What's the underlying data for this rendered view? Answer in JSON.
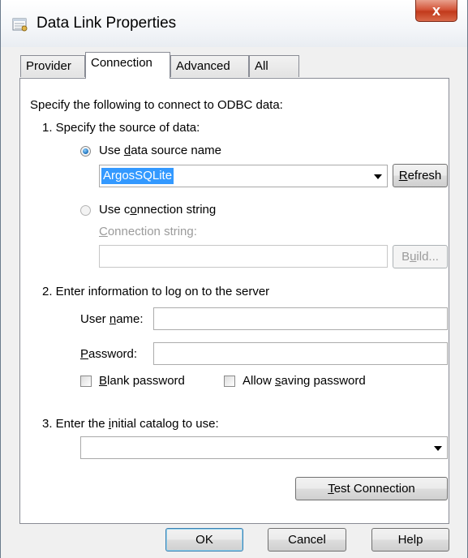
{
  "window": {
    "title": "Data Link Properties",
    "close_glyph": "x",
    "icon": "data-link-icon"
  },
  "tabs": [
    {
      "label": "Provider",
      "active": false
    },
    {
      "label": "Connection",
      "active": true
    },
    {
      "label": "Advanced",
      "active": false
    },
    {
      "label": "All",
      "active": false
    }
  ],
  "connection": {
    "intro": "Specify the following to connect to ODBC data:",
    "step1": "1. Specify the source of data:",
    "use_dsn_pre": "Use ",
    "use_dsn_accel": "d",
    "use_dsn_post": "ata source name",
    "dsn_value": "ArgosSQLite",
    "refresh_accel": "R",
    "refresh_post": "efresh",
    "use_connstr_pre": "Use c",
    "use_connstr_accel": "o",
    "use_connstr_post": "nnection string",
    "connstr_label_accel": "C",
    "connstr_label_post": "onnection string:",
    "connstr_value": "",
    "build_pre": "B",
    "build_accel": "u",
    "build_post": "ild...",
    "step2": "2. Enter information to log on to the server",
    "username_pre": "User ",
    "username_accel": "n",
    "username_post": "ame:",
    "username_value": "",
    "password_accel": "P",
    "password_post": "assword:",
    "password_value": "",
    "blank_pw_accel": "B",
    "blank_pw_post": "lank password",
    "allow_save_pre": "Allow ",
    "allow_save_accel": "s",
    "allow_save_post": "aving password",
    "step3_pre": "3. Enter the ",
    "step3_accel": "i",
    "step3_post": "nitial catalog to use:",
    "catalog_value": "",
    "test_accel": "T",
    "test_post": "est Connection"
  },
  "footer": {
    "ok": "OK",
    "cancel": "Cancel",
    "help": "Help"
  },
  "colors": {
    "selection": "#3399ff",
    "close_button": "#c23a1c",
    "panel_border": "#898c95"
  }
}
